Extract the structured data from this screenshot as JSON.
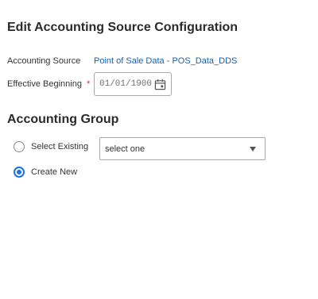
{
  "page": {
    "title": "Edit Accounting Source Configuration"
  },
  "accounting_source": {
    "label": "Accounting Source",
    "value": "Point of Sale Data - POS_Data_DDS"
  },
  "effective_beginning": {
    "label": "Effective Beginning",
    "required_marker": "*",
    "placeholder": "01/01/1900",
    "icon": "calendar-icon"
  },
  "accounting_group": {
    "title": "Accounting Group",
    "options": [
      {
        "label": "Select Existing",
        "checked": false
      },
      {
        "label": "Create New",
        "checked": true
      }
    ],
    "select": {
      "value": "select one",
      "icon": "chevron-down-icon"
    }
  },
  "colors": {
    "link": "#1a5fa8",
    "accent": "#1a73e8",
    "required": "#d32f2f"
  }
}
